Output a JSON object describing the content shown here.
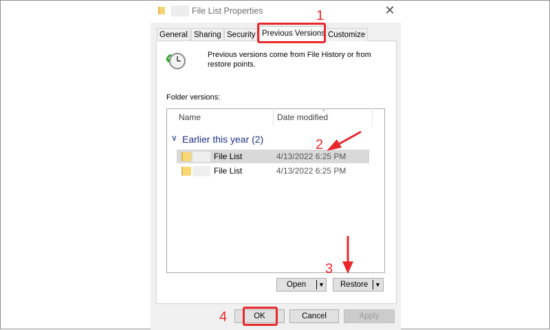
{
  "window": {
    "title": "File List Properties",
    "close_glyph": "✕"
  },
  "tabs": [
    {
      "label": "General"
    },
    {
      "label": "Sharing"
    },
    {
      "label": "Security"
    },
    {
      "label": "Previous Versions"
    },
    {
      "label": "Customize"
    }
  ],
  "intro_text": "Previous versions come from File History or from restore points.",
  "folder_versions_label": "Folder versions:",
  "columns": {
    "name": "Name",
    "date_modified": "Date modified"
  },
  "group": {
    "label": "Earlier this year (2)",
    "chevron": "∨"
  },
  "rows": [
    {
      "name": "File List",
      "date": "4/13/2022 6:25 PM"
    },
    {
      "name": "File List",
      "date": "4/13/2022 6:25 PM"
    }
  ],
  "buttons": {
    "open": "Open",
    "restore": "Restore",
    "ok": "OK",
    "cancel": "Cancel",
    "apply": "Apply"
  },
  "annotations": [
    "1",
    "2",
    "3",
    "4"
  ],
  "colors": {
    "accent_red": "#e8272b",
    "group_blue": "#1e3287"
  }
}
